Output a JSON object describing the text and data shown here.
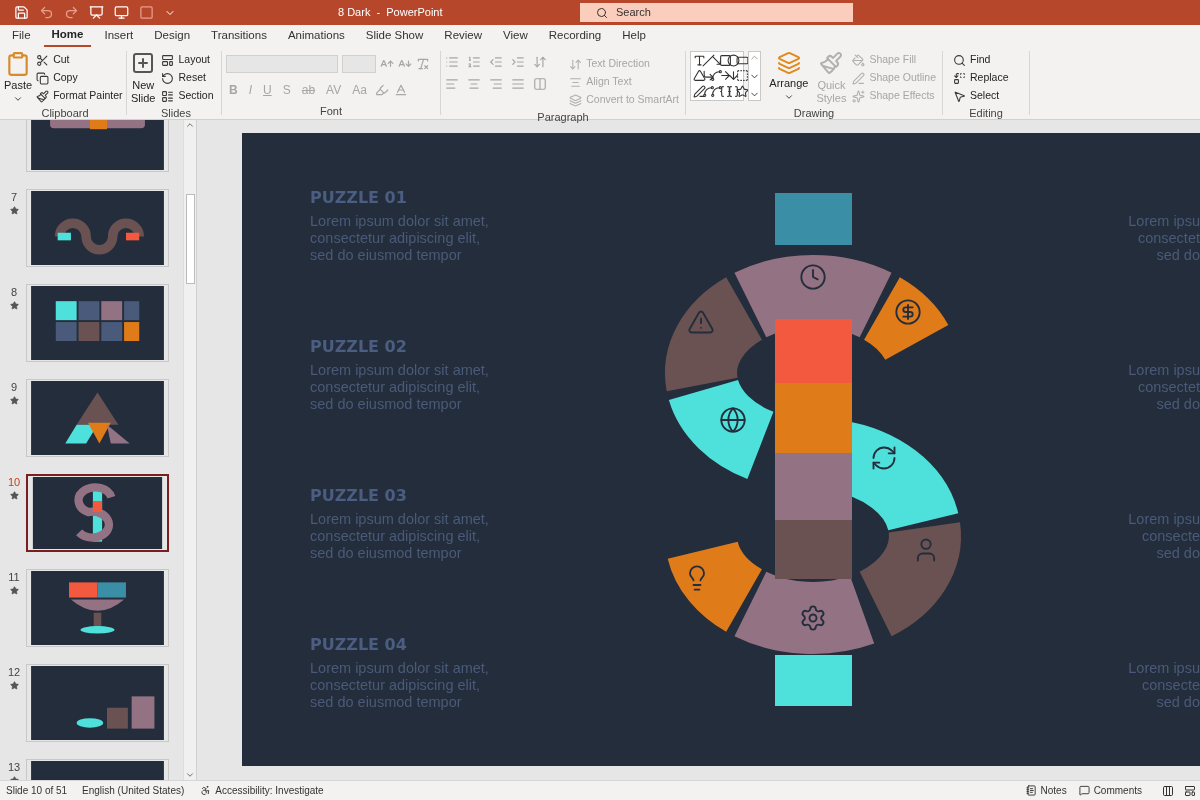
{
  "window": {
    "title": "8 Dark  -  PowerPoint"
  },
  "search": {
    "placeholder": "Search"
  },
  "tabs": [
    {
      "label": "File",
      "selected": false
    },
    {
      "label": "Home",
      "selected": true
    },
    {
      "label": "Insert",
      "selected": false
    },
    {
      "label": "Design",
      "selected": false
    },
    {
      "label": "Transitions",
      "selected": false
    },
    {
      "label": "Animations",
      "selected": false
    },
    {
      "label": "Slide Show",
      "selected": false
    },
    {
      "label": "Review",
      "selected": false
    },
    {
      "label": "View",
      "selected": false
    },
    {
      "label": "Recording",
      "selected": false
    },
    {
      "label": "Help",
      "selected": false
    }
  ],
  "ribbon": {
    "clipboard": {
      "label": "Clipboard",
      "paste": "Paste",
      "items": [
        {
          "label": "Cut",
          "disabled": false
        },
        {
          "label": "Copy",
          "disabled": false
        },
        {
          "label": "Format Painter",
          "disabled": false
        }
      ]
    },
    "slides": {
      "label": "Slides",
      "new_slide": [
        "New",
        "Slide"
      ],
      "items": [
        {
          "label": "Layout",
          "disabled": false
        },
        {
          "label": "Reset",
          "disabled": false
        },
        {
          "label": "Section",
          "disabled": false
        }
      ]
    },
    "font": {
      "label": "Font",
      "buttons": [
        {
          "label": "B",
          "disabled": true
        },
        {
          "label": "I",
          "disabled": true
        },
        {
          "label": "U",
          "disabled": true
        },
        {
          "label": "S",
          "disabled": true
        },
        {
          "label": "ab",
          "disabled": true
        },
        {
          "label": "AV",
          "disabled": true
        },
        {
          "label": "Aa",
          "disabled": true
        }
      ]
    },
    "paragraph": {
      "label": "Paragraph",
      "items": [
        {
          "label": "Text Direction",
          "disabled": true
        },
        {
          "label": "Align Text",
          "disabled": true
        },
        {
          "label": "Convert to SmartArt",
          "disabled": true
        }
      ]
    },
    "drawing": {
      "label": "Drawing",
      "arrange": "Arrange",
      "quick_styles": {
        "label": [
          "Quick",
          "Styles"
        ],
        "disabled": true
      },
      "items": [
        {
          "label": "Shape Fill",
          "disabled": true
        },
        {
          "label": "Shape Outline",
          "disabled": true
        },
        {
          "label": "Shape Effects",
          "disabled": true
        }
      ]
    },
    "editing": {
      "label": "Editing",
      "items": [
        {
          "label": "Find",
          "disabled": false
        },
        {
          "label": "Replace",
          "disabled": false
        },
        {
          "label": "Select",
          "disabled": false
        }
      ]
    }
  },
  "slides": [
    {
      "selected": false
    },
    {
      "number": "7",
      "selected": false
    },
    {
      "number": "8",
      "selected": false
    },
    {
      "number": "9",
      "selected": false
    },
    {
      "number": "10",
      "selected": true
    },
    {
      "number": "11",
      "selected": false
    },
    {
      "number": "12",
      "selected": false
    },
    {
      "number": "13",
      "selected": false
    }
  ],
  "slide": {
    "left_blocks": [
      {
        "title": "PUZZLE 01",
        "body": "Lorem ipsum dolor sit amet,\nconsectetur adipiscing elit,\nsed do eiusmod tempor"
      },
      {
        "title": "PUZZLE 02",
        "body": "Lorem ipsum dolor sit amet,\nconsectetur adipiscing elit,\nsed do eiusmod tempor"
      },
      {
        "title": "PUZZLE 03",
        "body": "Lorem ipsum dolor sit amet,\nconsectetur adipiscing elit,\nsed do eiusmod tempor"
      },
      {
        "title": "PUZZLE 04",
        "body": "Lorem ipsum dolor sit amet,\nconsectetur adipiscing elit,\nsed do eiusmod tempor"
      }
    ],
    "right_blocks": [
      {
        "body": "Lorem ipsu\nconsectet\nsed do"
      },
      {
        "body": "Lorem ipsu\nconsectet\nsed do"
      },
      {
        "body": "Lorem ipsu\nconsecte\nsed do"
      },
      {
        "body": "Lorem ipsu\nconsecte\nsed do"
      }
    ]
  },
  "status_bar": {
    "slide": "Slide 10 of 51",
    "language": "English (United States)",
    "accessibility": "Accessibility: Investigate",
    "notes": "Notes",
    "comments": "Comments"
  }
}
